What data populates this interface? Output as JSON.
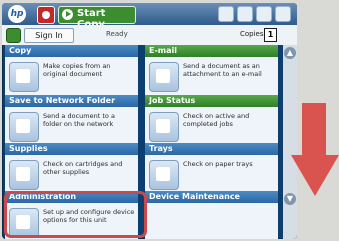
{
  "topbar": {
    "logo_text": "hp",
    "start_label": "Start Copy"
  },
  "signbar": {
    "sign_in_label": "Sign In",
    "status_text": "Ready",
    "copies_label": "Copies",
    "copies_value": "1"
  },
  "tiles": [
    {
      "title": "Copy",
      "description": "Make copies from an original document",
      "color": "#2a67a6",
      "icon": "copy-icon"
    },
    {
      "title": "E-mail",
      "description": "Send a document as an attachment to an e-mail",
      "color": "#2f7f26",
      "icon": "email-icon"
    },
    {
      "title": "Save to Network Folder",
      "description": "Send a document to a folder on the network",
      "color": "#2a67a6",
      "icon": "folder-icon"
    },
    {
      "title": "Job Status",
      "description": "Check on active and completed jobs",
      "color": "#2f7f26",
      "icon": "job-status-icon"
    },
    {
      "title": "Supplies",
      "description": "Check on cartridges and other supplies",
      "color": "#2a67a6",
      "icon": "supplies-icon"
    },
    {
      "title": "Trays",
      "description": "Check on paper trays",
      "color": "#2a67a6",
      "icon": "trays-icon"
    },
    {
      "title": "Administration",
      "description": "Set up and configure device options for this unit",
      "color": "#2a67a6",
      "icon": "administration-icon"
    },
    {
      "title": "Device Maintenance",
      "description": "",
      "color": "#2a67a6",
      "icon": "maintenance-icon"
    }
  ],
  "overlay": {
    "highlight_color": "#c94a4a",
    "arrow_color": "#d9534f"
  }
}
